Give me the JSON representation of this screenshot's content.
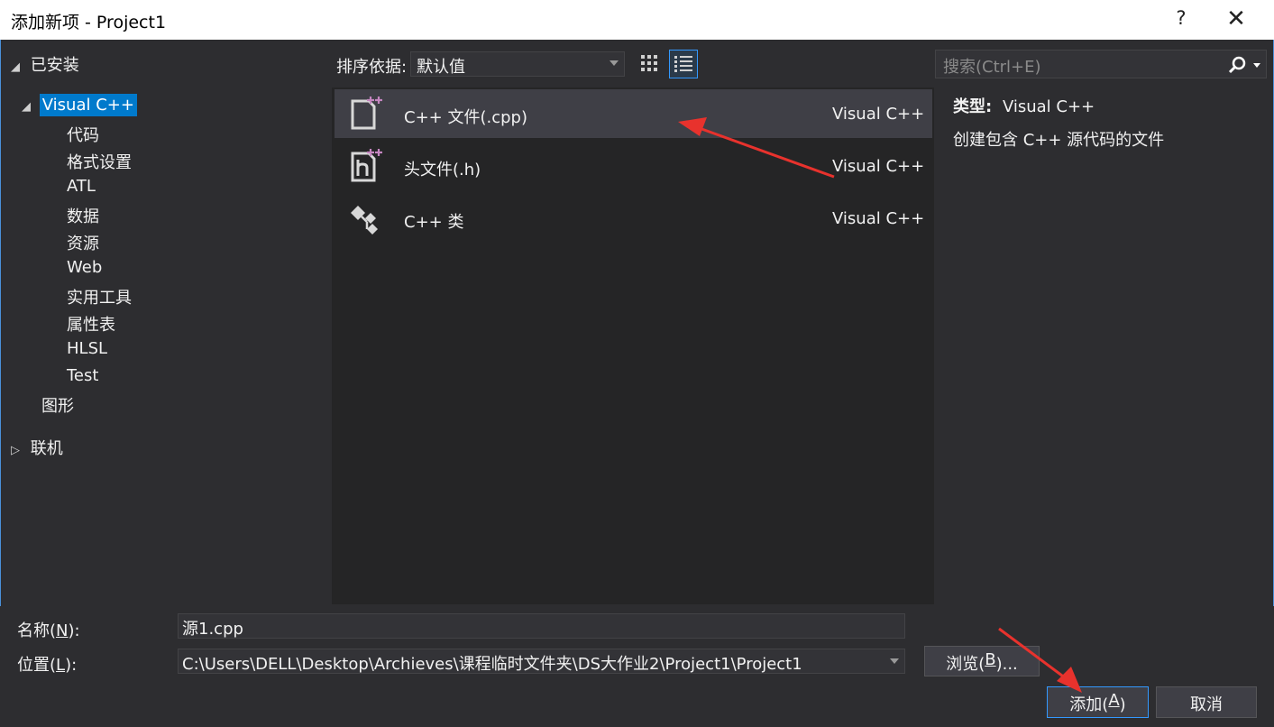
{
  "window": {
    "title": "添加新项 - Project1",
    "help": "?",
    "close": "✕"
  },
  "tree": {
    "installed": "已安装",
    "visual_cpp": "Visual C++",
    "children": [
      "代码",
      "格式设置",
      "ATL",
      "数据",
      "资源",
      "Web",
      "实用工具",
      "属性表",
      "HLSL",
      "Test"
    ],
    "graphics": "图形",
    "online": "联机"
  },
  "toolbar": {
    "sort_label": "排序依据:",
    "sort_value": "默认值"
  },
  "search": {
    "placeholder": "搜索(Ctrl+E)"
  },
  "templates": [
    {
      "name": "C++ 文件(.cpp)",
      "lang": "Visual C++",
      "icon": "cpp-file-icon",
      "selected": true
    },
    {
      "name": "头文件(.h)",
      "lang": "Visual C++",
      "icon": "header-file-icon",
      "selected": false
    },
    {
      "name": "C++ 类",
      "lang": "Visual C++",
      "icon": "cpp-class-icon",
      "selected": false
    }
  ],
  "details": {
    "type_key": "类型:",
    "type_value": "Visual C++",
    "description": "创建包含 C++ 源代码的文件"
  },
  "form": {
    "name_label_pre": "名称(",
    "name_label_key": "N",
    "name_label_post": "):",
    "name_value": "源1.cpp",
    "location_label_pre": "位置(",
    "location_label_key": "L",
    "location_label_post": "):",
    "location_value": "C:\\Users\\DELL\\Desktop\\Archieves\\课程临时文件夹\\DS大作业2\\Project1\\Project1",
    "browse_pre": "浏览(",
    "browse_key": "B",
    "browse_post": ")...",
    "add_pre": "添加(",
    "add_key": "A",
    "add_post": ")",
    "cancel": "取消"
  },
  "colors": {
    "accent": "#007acc",
    "annotation_arrow": "#e8322d",
    "cpp_plus": "#b180d7"
  }
}
